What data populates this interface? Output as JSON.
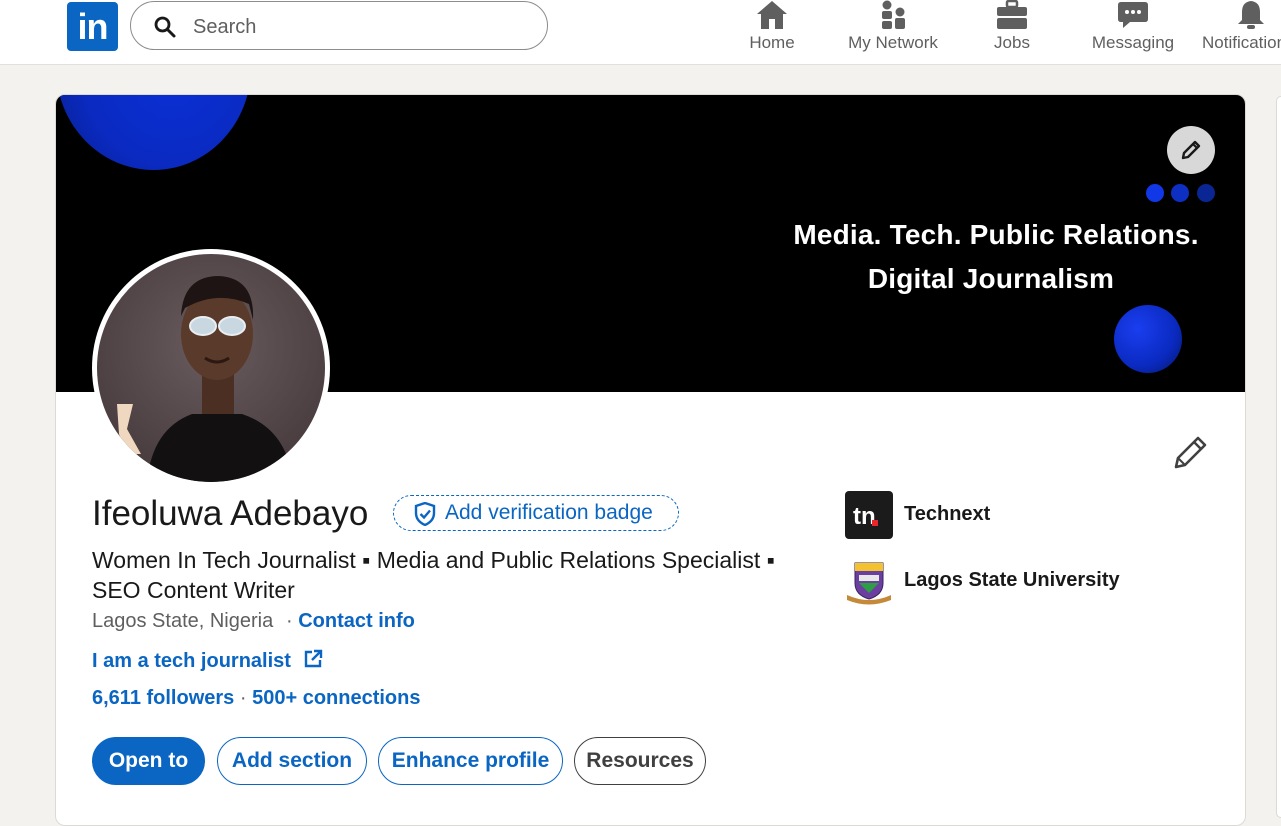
{
  "nav": {
    "logo_text": "in",
    "search_placeholder": "Search",
    "items": [
      {
        "label": "Home",
        "icon": "home-icon"
      },
      {
        "label": "My Network",
        "icon": "network-icon"
      },
      {
        "label": "Jobs",
        "icon": "briefcase-icon"
      },
      {
        "label": "Messaging",
        "icon": "messaging-icon"
      },
      {
        "label": "Notifications",
        "icon": "bell-icon"
      }
    ]
  },
  "banner": {
    "line1": "Media.  Tech.  Public Relations.",
    "line2": "Digital Journalism"
  },
  "profile": {
    "name": "Ifeoluwa Adebayo",
    "verification_badge": "Add verification badge",
    "headline": "Women In Tech Journalist ▪ Media and Public Relations Specialist ▪ SEO Content Writer",
    "location": "Lagos State, Nigeria",
    "contact_separator": "·",
    "contact_info": "Contact info",
    "website": "I am a tech journalist",
    "followers": "6,611 followers",
    "stats_separator": "·",
    "connections": "500+ connections"
  },
  "actions": {
    "open_to": "Open to",
    "add_section": "Add section",
    "enhance_profile": "Enhance profile",
    "resources": "Resources"
  },
  "experience": [
    {
      "name": "Technext",
      "logo_text": "tn"
    },
    {
      "name": "Lagos State University"
    }
  ],
  "colors": {
    "brand_blue": "#0a66c2",
    "banner_bg": "#000000",
    "banner_accent": "#0a2ac0",
    "page_bg": "#f4f2ee"
  }
}
